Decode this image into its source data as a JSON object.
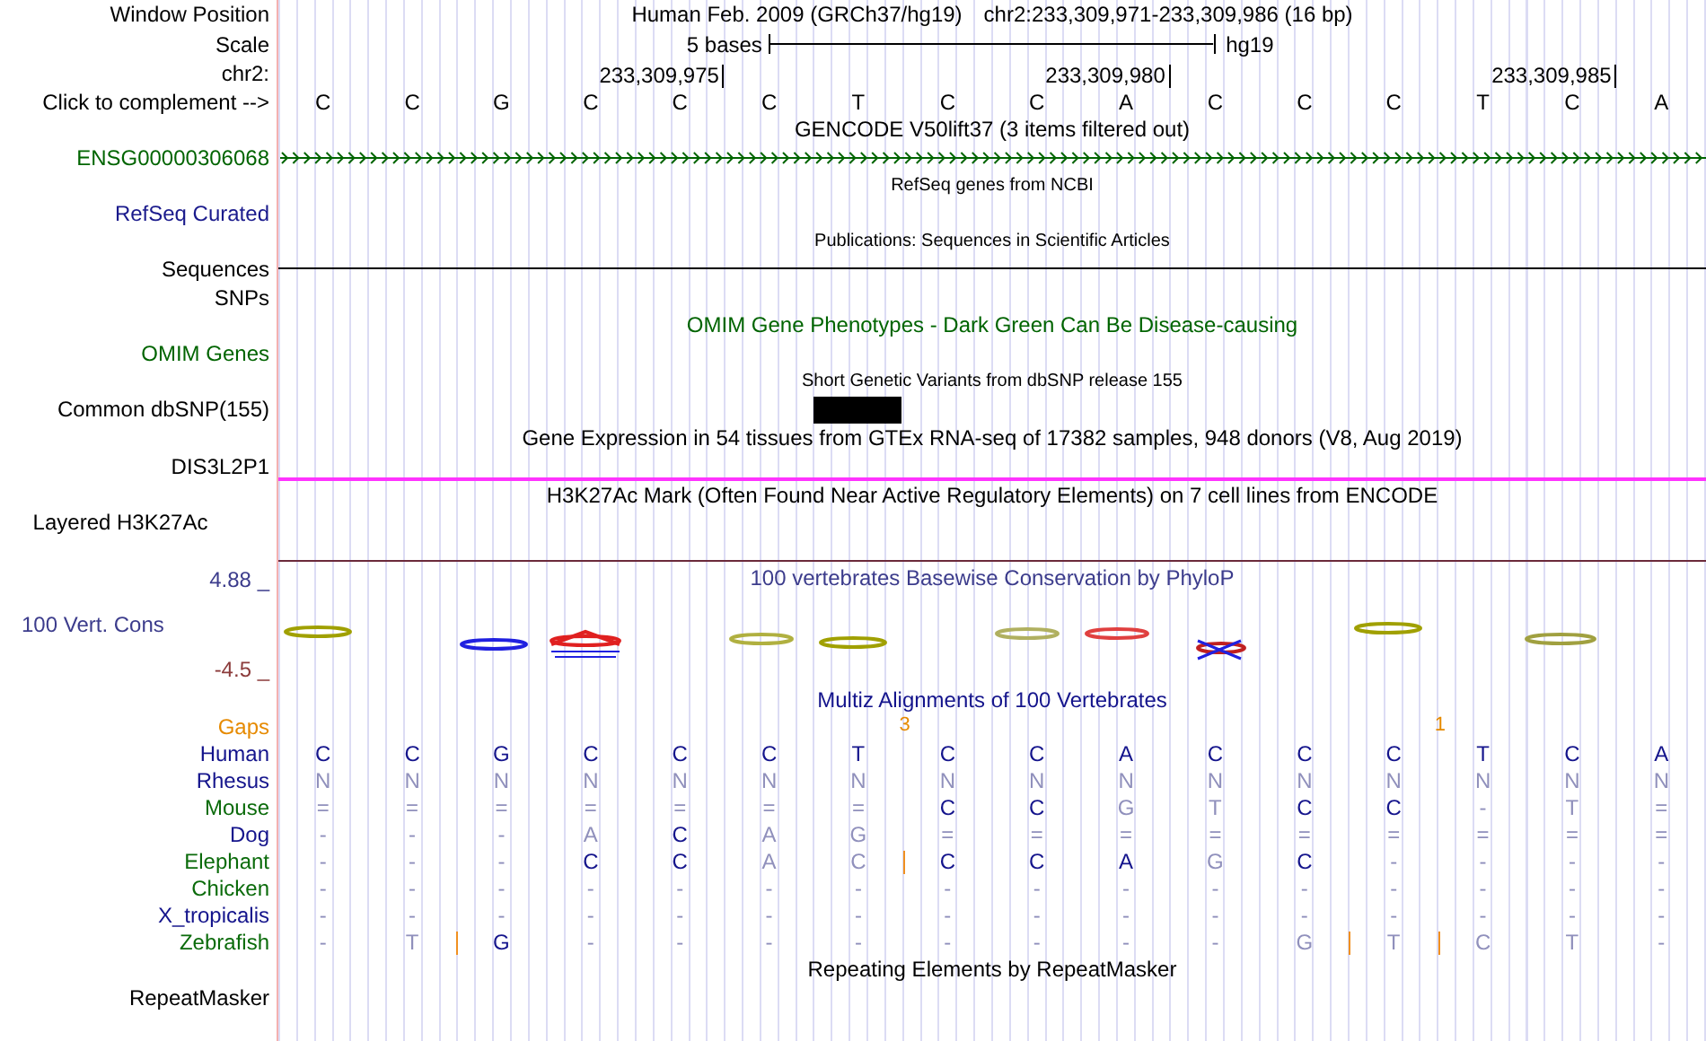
{
  "rows": [
    {
      "kind": "position",
      "label": "Window Position",
      "color": "#000000",
      "assembly": "Human Feb. 2009 (GRCh37/hg19)",
      "range": "chr2:233,309,971-233,309,986 (16 bp)"
    },
    {
      "kind": "scale",
      "label": "Scale",
      "color": "#000000",
      "length": "5 bases",
      "assembly": "hg19"
    },
    {
      "kind": "coords",
      "label": "chr2:",
      "color": "#000000",
      "ticks": [
        "233,309,975",
        "233,309,980",
        "233,309,985"
      ]
    },
    {
      "kind": "bases",
      "label": "Click to complement -->",
      "color": "#000000",
      "bases": [
        "C",
        "C",
        "G",
        "C",
        "C",
        "C",
        "T",
        "C",
        "C",
        "A",
        "C",
        "C",
        "C",
        "T",
        "C",
        "A"
      ]
    },
    {
      "kind": "title",
      "text": "GENCODE V50lift37 (3 items filtered out)",
      "color": "#000000"
    },
    {
      "kind": "gene",
      "label": "ENSG00000306068",
      "color": "#006400"
    },
    {
      "kind": "small_title",
      "text": "RefSeq genes from NCBI",
      "color": "#000000"
    },
    {
      "kind": "empty",
      "label": "RefSeq Curated",
      "color": "#1a1a8c"
    },
    {
      "kind": "small_title",
      "text": "Publications: Sequences in Scientific Articles",
      "color": "#000000"
    },
    {
      "kind": "line",
      "label": "Sequences",
      "color": "#000000"
    },
    {
      "kind": "empty",
      "label": "SNPs",
      "color": "#000000"
    },
    {
      "kind": "title",
      "text": "OMIM Gene Phenotypes - Dark Green Can Be Disease-causing",
      "color": "#006400"
    },
    {
      "kind": "empty",
      "label": "OMIM Genes",
      "color": "#006400"
    },
    {
      "kind": "small_title",
      "text": "Short Genetic Variants from dbSNP release 155",
      "color": "#000000"
    },
    {
      "kind": "block",
      "label": "Common dbSNP(155)",
      "color": "#000000"
    },
    {
      "kind": "title",
      "text": "Gene Expression in 54 tissues from GTEx RNA-seq of 17382 samples, 948 donors (V8, Aug 2019)",
      "color": "#000000"
    },
    {
      "kind": "divider",
      "label": "DIS3L2P1",
      "color": "#000000"
    },
    {
      "kind": "title",
      "text": "H3K27Ac Mark (Often Found Near Active Regulatory Elements) on 7 cell lines from ENCODE",
      "color": "#000000"
    },
    {
      "kind": "tall",
      "label": "Layered H3K27Ac",
      "color": "#000000"
    },
    {
      "kind": "conservation",
      "label": "100 Vert. Cons",
      "color": "#3c3c8c",
      "title": "100 vertebrates Basewise Conservation by PhyloP",
      "max": {
        "text": "4.88 _",
        "color": "#3c3c8c"
      },
      "min": {
        "text": "-4.5 _",
        "color": "#8c3c3c"
      }
    },
    {
      "kind": "title",
      "text": "Multiz Alignments of 100 Vertebrates",
      "color": "#14148c"
    },
    {
      "kind": "gaps",
      "label": "Gaps",
      "color": "#e68a00",
      "cells": [
        {},
        {},
        {},
        {},
        {},
        {},
        {
          "count_after": "3"
        },
        {},
        {},
        {},
        {},
        {},
        {
          "count_after": "1"
        },
        {},
        {},
        {}
      ]
    },
    {
      "kind": "species",
      "label": "Human",
      "color": "#14148c",
      "cells": [
        {
          "base": "C",
          "match": true,
          "gap": false
        },
        {
          "base": "C",
          "match": true,
          "gap": false
        },
        {
          "base": "G",
          "match": true,
          "gap": false
        },
        {
          "base": "C",
          "match": true,
          "gap": false
        },
        {
          "base": "C",
          "match": true,
          "gap": false
        },
        {
          "base": "C",
          "match": true,
          "gap": false
        },
        {
          "base": "T",
          "match": true,
          "gap": false
        },
        {
          "base": "C",
          "match": true,
          "gap": false
        },
        {
          "base": "C",
          "match": true,
          "gap": false
        },
        {
          "base": "A",
          "match": true,
          "gap": false
        },
        {
          "base": "C",
          "match": true,
          "gap": false
        },
        {
          "base": "C",
          "match": true,
          "gap": false
        },
        {
          "base": "C",
          "match": true,
          "gap": false
        },
        {
          "base": "T",
          "match": true,
          "gap": false
        },
        {
          "base": "C",
          "match": true,
          "gap": false
        },
        {
          "base": "A",
          "match": true,
          "gap": false
        }
      ]
    },
    {
      "kind": "species",
      "label": "Rhesus",
      "color": "#14148c",
      "cells": [
        {
          "base": "N",
          "match": false,
          "gap": false
        },
        {
          "base": "N",
          "match": false,
          "gap": false
        },
        {
          "base": "N",
          "match": false,
          "gap": false
        },
        {
          "base": "N",
          "match": false,
          "gap": false
        },
        {
          "base": "N",
          "match": false,
          "gap": false
        },
        {
          "base": "N",
          "match": false,
          "gap": false
        },
        {
          "base": "N",
          "match": false,
          "gap": false
        },
        {
          "base": "N",
          "match": false,
          "gap": false
        },
        {
          "base": "N",
          "match": false,
          "gap": false
        },
        {
          "base": "N",
          "match": false,
          "gap": false
        },
        {
          "base": "N",
          "match": false,
          "gap": false
        },
        {
          "base": "N",
          "match": false,
          "gap": false
        },
        {
          "base": "N",
          "match": false,
          "gap": false
        },
        {
          "base": "N",
          "match": false,
          "gap": false
        },
        {
          "base": "N",
          "match": false,
          "gap": false
        },
        {
          "base": "N",
          "match": false,
          "gap": false
        }
      ]
    },
    {
      "kind": "species",
      "label": "Mouse",
      "color": "#0b6b0b",
      "cells": [
        {
          "base": "=",
          "match": false,
          "gap": false
        },
        {
          "base": "=",
          "match": false,
          "gap": false
        },
        {
          "base": "=",
          "match": false,
          "gap": false
        },
        {
          "base": "=",
          "match": false,
          "gap": false
        },
        {
          "base": "=",
          "match": false,
          "gap": false
        },
        {
          "base": "=",
          "match": false,
          "gap": false
        },
        {
          "base": "=",
          "match": false,
          "gap": false
        },
        {
          "base": "C",
          "match": true,
          "gap": false
        },
        {
          "base": "C",
          "match": true,
          "gap": false
        },
        {
          "base": "G",
          "match": false,
          "gap": false
        },
        {
          "base": "T",
          "match": false,
          "gap": false
        },
        {
          "base": "C",
          "match": true,
          "gap": false
        },
        {
          "base": "C",
          "match": true,
          "gap": false
        },
        {
          "base": "-",
          "match": false,
          "gap": false
        },
        {
          "base": "T",
          "match": false,
          "gap": false
        },
        {
          "base": "=",
          "match": false,
          "gap": false
        }
      ]
    },
    {
      "kind": "species",
      "label": "Dog",
      "color": "#14148c",
      "cells": [
        {
          "base": "-",
          "match": false,
          "gap": false
        },
        {
          "base": "-",
          "match": false,
          "gap": false
        },
        {
          "base": "-",
          "match": false,
          "gap": false
        },
        {
          "base": "A",
          "match": false,
          "gap": false
        },
        {
          "base": "C",
          "match": true,
          "gap": false
        },
        {
          "base": "A",
          "match": false,
          "gap": false
        },
        {
          "base": "G",
          "match": false,
          "gap": false
        },
        {
          "base": "=",
          "match": false,
          "gap": false
        },
        {
          "base": "=",
          "match": false,
          "gap": false
        },
        {
          "base": "=",
          "match": false,
          "gap": false
        },
        {
          "base": "=",
          "match": false,
          "gap": false
        },
        {
          "base": "=",
          "match": false,
          "gap": false
        },
        {
          "base": "=",
          "match": false,
          "gap": false
        },
        {
          "base": "=",
          "match": false,
          "gap": false
        },
        {
          "base": "=",
          "match": false,
          "gap": false
        },
        {
          "base": "=",
          "match": false,
          "gap": false
        }
      ]
    },
    {
      "kind": "species",
      "label": "Elephant",
      "color": "#0b6b0b",
      "cells": [
        {
          "base": "-",
          "match": false,
          "gap": false
        },
        {
          "base": "-",
          "match": false,
          "gap": false
        },
        {
          "base": "-",
          "match": false,
          "gap": false
        },
        {
          "base": "C",
          "match": true,
          "gap": false
        },
        {
          "base": "C",
          "match": true,
          "gap": false
        },
        {
          "base": "A",
          "match": false,
          "gap": false
        },
        {
          "base": "C",
          "match": false,
          "gap": true
        },
        {
          "base": "C",
          "match": true,
          "gap": false
        },
        {
          "base": "C",
          "match": true,
          "gap": false
        },
        {
          "base": "A",
          "match": true,
          "gap": false
        },
        {
          "base": "G",
          "match": false,
          "gap": false
        },
        {
          "base": "C",
          "match": true,
          "gap": false
        },
        {
          "base": "-",
          "match": false,
          "gap": false
        },
        {
          "base": "-",
          "match": false,
          "gap": false
        },
        {
          "base": "-",
          "match": false,
          "gap": false
        },
        {
          "base": "-",
          "match": false,
          "gap": false
        }
      ]
    },
    {
      "kind": "species",
      "label": "Chicken",
      "color": "#0b6b0b",
      "cells": [
        {
          "base": "-",
          "match": false,
          "gap": false
        },
        {
          "base": "-",
          "match": false,
          "gap": false
        },
        {
          "base": "-",
          "match": false,
          "gap": false
        },
        {
          "base": "-",
          "match": false,
          "gap": false
        },
        {
          "base": "-",
          "match": false,
          "gap": false
        },
        {
          "base": "-",
          "match": false,
          "gap": false
        },
        {
          "base": "-",
          "match": false,
          "gap": false
        },
        {
          "base": "-",
          "match": false,
          "gap": false
        },
        {
          "base": "-",
          "match": false,
          "gap": false
        },
        {
          "base": "-",
          "match": false,
          "gap": false
        },
        {
          "base": "-",
          "match": false,
          "gap": false
        },
        {
          "base": "-",
          "match": false,
          "gap": false
        },
        {
          "base": "-",
          "match": false,
          "gap": false
        },
        {
          "base": "-",
          "match": false,
          "gap": false
        },
        {
          "base": "-",
          "match": false,
          "gap": false
        },
        {
          "base": "-",
          "match": false,
          "gap": false
        }
      ]
    },
    {
      "kind": "species",
      "label": "X_tropicalis",
      "color": "#14148c",
      "cells": [
        {
          "base": "-",
          "match": false,
          "gap": false
        },
        {
          "base": "-",
          "match": false,
          "gap": false
        },
        {
          "base": "-",
          "match": false,
          "gap": false
        },
        {
          "base": "-",
          "match": false,
          "gap": false
        },
        {
          "base": "-",
          "match": false,
          "gap": false
        },
        {
          "base": "-",
          "match": false,
          "gap": false
        },
        {
          "base": "-",
          "match": false,
          "gap": false
        },
        {
          "base": "-",
          "match": false,
          "gap": false
        },
        {
          "base": "-",
          "match": false,
          "gap": false
        },
        {
          "base": "-",
          "match": false,
          "gap": false
        },
        {
          "base": "-",
          "match": false,
          "gap": false
        },
        {
          "base": "-",
          "match": false,
          "gap": false
        },
        {
          "base": "-",
          "match": false,
          "gap": false
        },
        {
          "base": "-",
          "match": false,
          "gap": false
        },
        {
          "base": "-",
          "match": false,
          "gap": false
        },
        {
          "base": "-",
          "match": false,
          "gap": false
        }
      ]
    },
    {
      "kind": "species",
      "label": "Zebrafish",
      "color": "#0b6b0b",
      "cells": [
        {
          "base": "-",
          "match": false,
          "gap": false
        },
        {
          "base": "T",
          "match": false,
          "gap": true
        },
        {
          "base": "G",
          "match": true,
          "gap": false
        },
        {
          "base": "-",
          "match": false,
          "gap": false
        },
        {
          "base": "-",
          "match": false,
          "gap": false
        },
        {
          "base": "-",
          "match": false,
          "gap": false
        },
        {
          "base": "-",
          "match": false,
          "gap": false
        },
        {
          "base": "-",
          "match": false,
          "gap": false
        },
        {
          "base": "-",
          "match": false,
          "gap": false
        },
        {
          "base": "-",
          "match": false,
          "gap": false
        },
        {
          "base": "-",
          "match": false,
          "gap": false
        },
        {
          "base": "G",
          "match": false,
          "gap": true
        },
        {
          "base": "T",
          "match": false,
          "gap": true
        },
        {
          "base": "C",
          "match": false,
          "gap": false
        },
        {
          "base": "T",
          "match": false,
          "gap": false
        },
        {
          "base": "-",
          "match": false,
          "gap": false
        }
      ]
    },
    {
      "kind": "title",
      "text": "Repeating Elements by RepeatMasker",
      "color": "#000000"
    },
    {
      "kind": "empty",
      "label": "RepeatMasker",
      "color": "#000000"
    }
  ]
}
